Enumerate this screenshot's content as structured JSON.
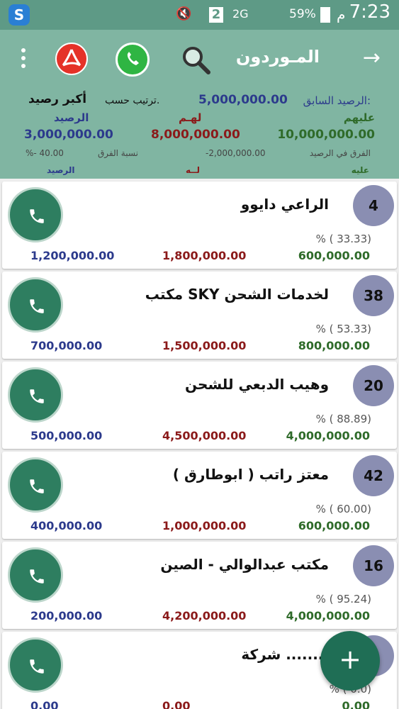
{
  "status_bar": {
    "time": "7:23",
    "am_pm": "م",
    "battery": "59%",
    "network": "2G",
    "sim": "2"
  },
  "toolbar": {
    "title": "المـوردون",
    "back_icon": "arrow-right-icon",
    "search_icon": "search-icon",
    "whatsapp_icon": "whatsapp-icon",
    "pdf_icon": "pdf-icon",
    "menu_icon": "more-vert-icon"
  },
  "summary": {
    "prev_balance_label": "الرصيد السابق:",
    "prev_balance_value": "5,000,000.00",
    "sort_by_label": "ترتيب حسب.",
    "sort_by_value": "أكبر رصيد",
    "they_owe_label": "عليهم",
    "they_owe_value": "10,000,000.00",
    "owed_to_them_label": "لهـم",
    "owed_to_them_value": "8,000,000.00",
    "balance_label": "الرصيد",
    "balance_value": "3,000,000.00",
    "diff_label": "الفرق في الرصيد",
    "diff_value": "-2,000,000.00",
    "diff_pct_label": "نسبة الفرق",
    "diff_pct_value": "%- 40.00",
    "bottom_label_green": "عليه",
    "bottom_label_red": "لــه",
    "bottom_label_blue": "الرصيد"
  },
  "suppliers": [
    {
      "count": "4",
      "name": "الراعي دايوو",
      "pct": "% ( 33.33)",
      "debit": "600,000.00",
      "credit": "1,800,000.00",
      "balance": "1,200,000.00"
    },
    {
      "count": "38",
      "name": "مكتب SKY لخدمات الشحن",
      "pct": "% ( 53.33)",
      "debit": "800,000.00",
      "credit": "1,500,000.00",
      "balance": "700,000.00"
    },
    {
      "count": "20",
      "name": "وهيب الدبعي للشحن",
      "pct": "% ( 88.89)",
      "debit": "4,000,000.00",
      "credit": "4,500,000.00",
      "balance": "500,000.00"
    },
    {
      "count": "42",
      "name": "معتز راتب ( ابوطارق )",
      "pct": "% ( 60.00)",
      "debit": "600,000.00",
      "credit": "1,000,000.00",
      "balance": "400,000.00"
    },
    {
      "count": "16",
      "name": "مكتب عبدالوالي - الصين",
      "pct": "% ( 95.24)",
      "debit": "4,000,000.00",
      "credit": "4,200,000.00",
      "balance": "200,000.00"
    },
    {
      "count": "",
      "name": "شركة ........",
      "pct": "% ( 0.0)",
      "debit": "0.00",
      "credit": "0.00",
      "balance": "0.00"
    }
  ],
  "fab": {
    "label": "+"
  }
}
